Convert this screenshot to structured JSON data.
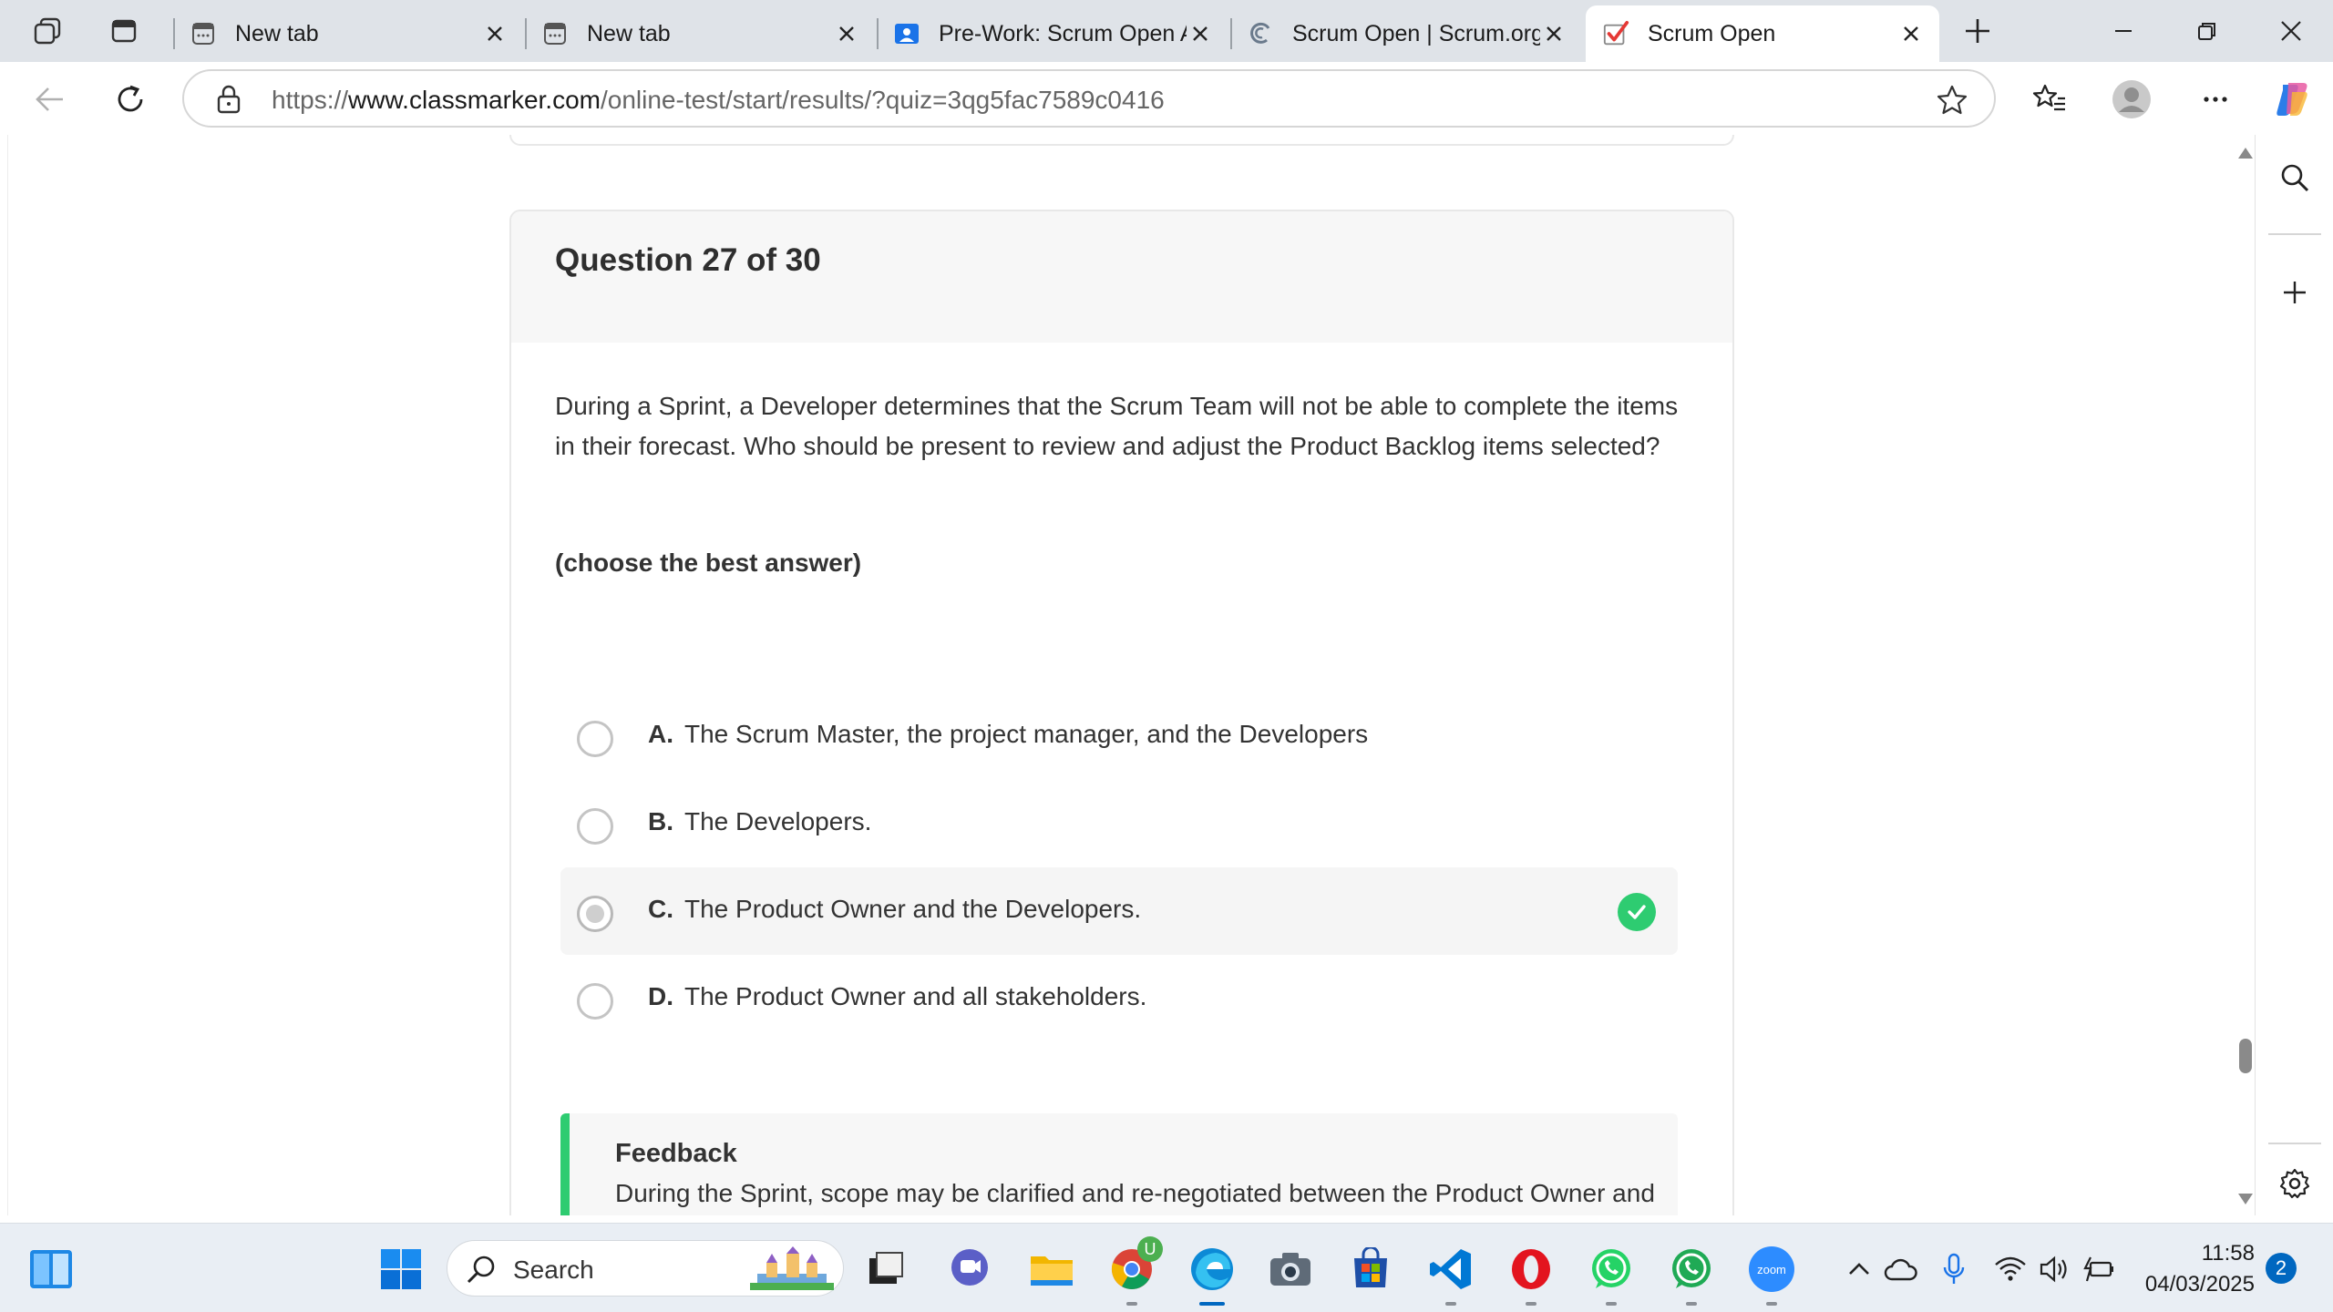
{
  "tabs": [
    {
      "title": "New tab",
      "icon": "new-tab-icon"
    },
    {
      "title": "New tab",
      "icon": "new-tab-icon"
    },
    {
      "title": "Pre-Work: Scrum Open A",
      "icon": "classroom-icon"
    },
    {
      "title": "Scrum Open | Scrum.org",
      "icon": "scrum-org-icon"
    },
    {
      "title": "Scrum Open",
      "icon": "classmarker-check-icon",
      "active": true
    }
  ],
  "address_bar": {
    "scheme": "https://",
    "host": "www.classmarker.com",
    "path": "/online-test/start/results/?quiz=3qg5fac7589c0416"
  },
  "question": {
    "heading": "Question 27 of 30",
    "text": "During a Sprint, a Developer determines that the Scrum Team will not be able to complete the items in their forecast. Who should be present to review and adjust the Product Backlog items selected?",
    "hint": "(choose the best answer)",
    "answers": [
      {
        "letter": "A.",
        "text": "The Scrum Master, the project manager, and the Developers",
        "selected": false,
        "correct": false
      },
      {
        "letter": "B.",
        "text": "The Developers.",
        "selected": false,
        "correct": false
      },
      {
        "letter": "C.",
        "text": "The Product Owner and the Developers.",
        "selected": true,
        "correct": true
      },
      {
        "letter": "D.",
        "text": "The Product Owner and all stakeholders.",
        "selected": false,
        "correct": false
      }
    ]
  },
  "feedback": {
    "title": "Feedback",
    "text": "During the Sprint, scope may be clarified and re-negotiated between the Product Owner and the Developers as more is learned. It is important to be transparent when challenges arise since ultimately the entire Scrum Team is accountable for creating a valuable,"
  },
  "taskbar": {
    "search_label": "Search",
    "time": "11:58",
    "date": "04/03/2025",
    "notification_count": "2",
    "chrome_badge": "U",
    "zoom_label": "zoom"
  },
  "colors": {
    "correct_green": "#2ecc71",
    "accent_blue": "#0067c0",
    "tabstrip_bg": "#dfe3e8"
  }
}
